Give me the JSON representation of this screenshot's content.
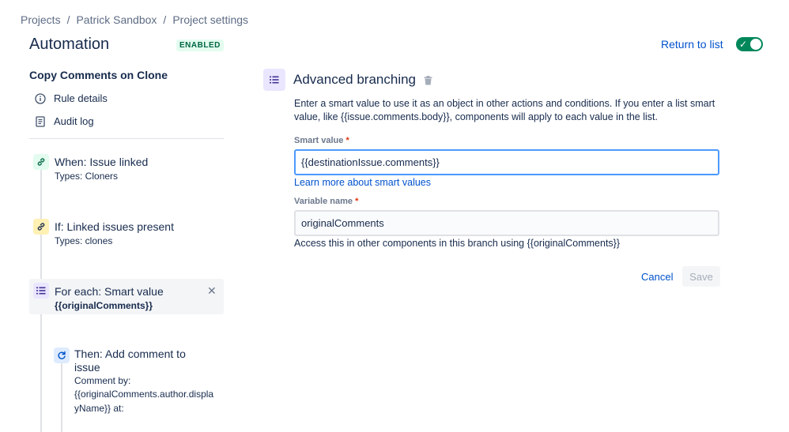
{
  "breadcrumb": {
    "items": [
      "Projects",
      "Patrick Sandbox",
      "Project settings"
    ],
    "separator": "/"
  },
  "header": {
    "title": "Automation",
    "status_badge": "ENABLED",
    "return_link": "Return to list",
    "toggle_on": true
  },
  "sidebar": {
    "rule_name": "Copy Comments on Clone",
    "nav": [
      {
        "label": "Rule details",
        "icon": "info-icon"
      },
      {
        "label": "Audit log",
        "icon": "document-icon"
      }
    ],
    "components": [
      {
        "title": "When: Issue linked",
        "subtitle": "Types: Cloners",
        "icon": "link-icon",
        "color": "#e3fcef"
      },
      {
        "title": "If: Linked issues present",
        "subtitle": "Types: clones",
        "icon": "link-icon",
        "color": "#fff0b3"
      },
      {
        "title": "For each: Smart value",
        "subtitle": "{{originalComments}}",
        "icon": "list-icon",
        "color": "#eae6ff"
      },
      {
        "title_line1": "Then: Add comment to",
        "title_line2": "issue",
        "sub_line1": "Comment by:",
        "sub_line2": "{{originalComments.author.displa",
        "sub_line3": "yName}} at:",
        "icon": "refresh-icon",
        "color": "#deebff"
      }
    ]
  },
  "panel": {
    "title": "Advanced branching",
    "description": "Enter a smart value to use it as an object in other actions and conditions. If you enter a list smart value, like {{issue.comments.body}}, components will apply to each value in the list.",
    "smart_value_label": "Smart value",
    "smart_value": "{{destinationIssue.comments}}",
    "learn_more": "Learn more about smart values",
    "variable_label": "Variable name",
    "variable_value": "originalComments",
    "variable_help": "Access this in other components in this branch using {{originalComments}}",
    "required_mark": "*",
    "cancel": "Cancel",
    "save": "Save"
  }
}
